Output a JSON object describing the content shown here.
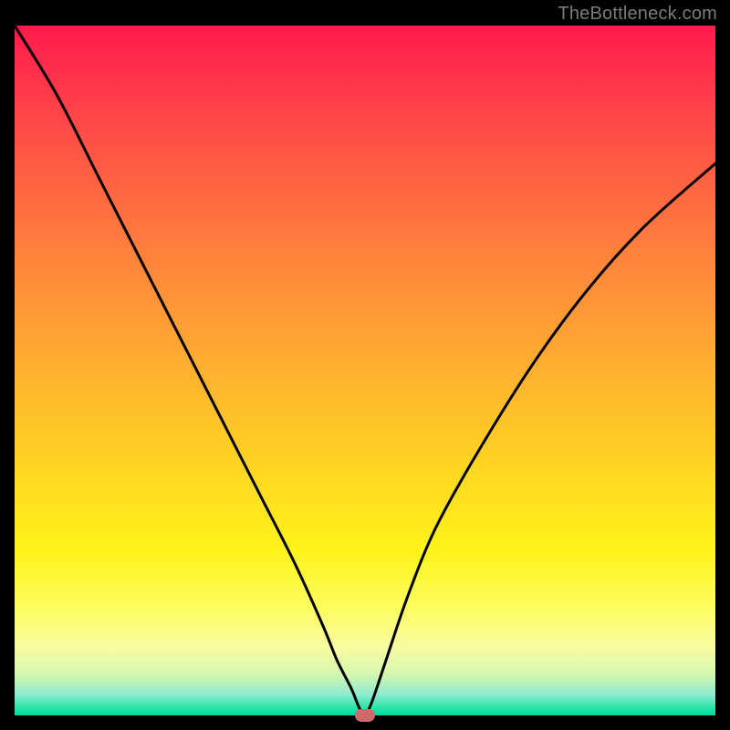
{
  "watermark": "TheBottleneck.com",
  "chart_data": {
    "type": "line",
    "title": "",
    "xlabel": "",
    "ylabel": "",
    "xlim": [
      0,
      100
    ],
    "ylim": [
      0,
      100
    ],
    "grid": false,
    "legend": false,
    "series": [
      {
        "name": "bottleneck-curve",
        "x": [
          0,
          6,
          12,
          18,
          24,
          30,
          35,
          40,
          44,
          46,
          48,
          49,
          49.5,
          50,
          51,
          53,
          56,
          60,
          66,
          74,
          82,
          90,
          100
        ],
        "y": [
          100,
          90,
          78,
          66,
          54,
          42,
          32,
          22,
          13,
          8,
          4,
          1.5,
          0.5,
          0,
          2,
          8,
          17,
          27,
          38,
          51,
          62,
          71,
          80
        ]
      }
    ],
    "marker": {
      "x": 50,
      "y": 0,
      "color": "#cf6a6a"
    },
    "background_gradient": {
      "stops": [
        {
          "pct": 0,
          "color": "#ff1a4d"
        },
        {
          "pct": 50,
          "color": "#ffb02f"
        },
        {
          "pct": 76,
          "color": "#fff31a"
        },
        {
          "pct": 100,
          "color": "#00dca0"
        }
      ]
    }
  }
}
